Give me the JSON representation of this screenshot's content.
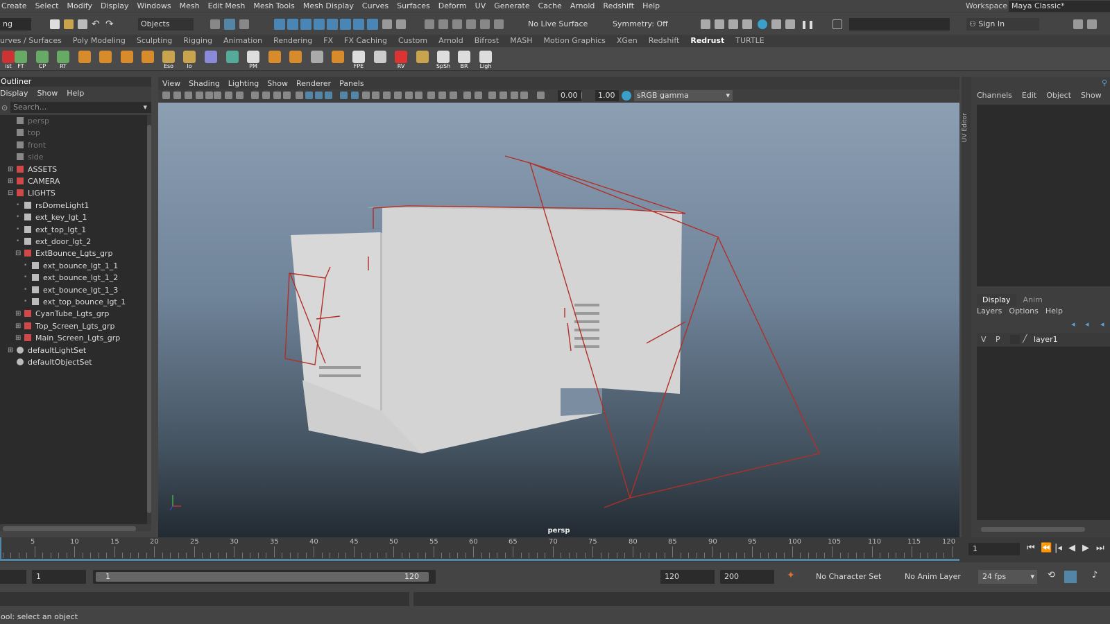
{
  "menubar": {
    "items": [
      "Create",
      "Select",
      "Modify",
      "Display",
      "Windows",
      "Mesh",
      "Edit Mesh",
      "Mesh Tools",
      "Mesh Display",
      "Curves",
      "Surfaces",
      "Deform",
      "UV",
      "Generate",
      "Cache",
      "Arnold",
      "Redshift",
      "Help"
    ],
    "workspace_label": "Workspace :",
    "workspace_value": "Maya Classic*"
  },
  "statusline": {
    "mode_dropdown": "ng",
    "objects_label": "Objects",
    "live_surface": "No Live Surface",
    "symmetry": "Symmetry: Off",
    "sign_in": "Sign In"
  },
  "shelf": {
    "tabs": [
      "urves / Surfaces",
      "Poly Modeling",
      "Sculpting",
      "Rigging",
      "Animation",
      "Rendering",
      "FX",
      "FX Caching",
      "Custom",
      "Arnold",
      "Bifrost",
      "MASH",
      "Motion Graphics",
      "XGen",
      "Redshift",
      "Redrust",
      "TURTLE"
    ],
    "active_tab": "Redrust",
    "icon_labels": [
      "ist",
      "FT",
      "CP",
      "RT",
      "",
      "",
      "",
      "",
      "Eso",
      "Io",
      "",
      "",
      "PM",
      "",
      "",
      "",
      "",
      "FPE",
      "",
      "RV",
      "",
      "SpSh",
      "BR",
      "Ligh"
    ]
  },
  "outliner": {
    "title": "Outliner",
    "menu": [
      "Display",
      "Show",
      "Help"
    ],
    "search_placeholder": "Search...",
    "items": [
      {
        "label": "persp",
        "indent": 0,
        "type": "camera",
        "dim": true
      },
      {
        "label": "top",
        "indent": 0,
        "type": "camera",
        "dim": true
      },
      {
        "label": "front",
        "indent": 0,
        "type": "camera",
        "dim": true
      },
      {
        "label": "side",
        "indent": 0,
        "type": "camera",
        "dim": true
      },
      {
        "label": "ASSETS",
        "indent": 0,
        "type": "group",
        "expand": "+"
      },
      {
        "label": "CAMERA",
        "indent": 0,
        "type": "group",
        "expand": "+"
      },
      {
        "label": "LIGHTS",
        "indent": 0,
        "type": "group",
        "expand": "-"
      },
      {
        "label": "rsDomeLight1",
        "indent": 1,
        "type": "light"
      },
      {
        "label": "ext_key_lgt_1",
        "indent": 1,
        "type": "light"
      },
      {
        "label": "ext_top_lgt_1",
        "indent": 1,
        "type": "light"
      },
      {
        "label": "ext_door_lgt_2",
        "indent": 1,
        "type": "light"
      },
      {
        "label": "ExtBounce_Lgts_grp",
        "indent": 1,
        "type": "group",
        "expand": "-"
      },
      {
        "label": "ext_bounce_lgt_1_1",
        "indent": 2,
        "type": "light"
      },
      {
        "label": "ext_bounce_lgt_1_2",
        "indent": 2,
        "type": "light"
      },
      {
        "label": "ext_bounce_lgt_1_3",
        "indent": 2,
        "type": "light"
      },
      {
        "label": "ext_top_bounce_lgt_1",
        "indent": 2,
        "type": "light"
      },
      {
        "label": "CyanTube_Lgts_grp",
        "indent": 1,
        "type": "group",
        "expand": "+"
      },
      {
        "label": "Top_Screen_Lgts_grp",
        "indent": 1,
        "type": "group",
        "expand": "+"
      },
      {
        "label": "Main_Screen_Lgts_grp",
        "indent": 1,
        "type": "group",
        "expand": "+"
      },
      {
        "label": "defaultLightSet",
        "indent": 0,
        "type": "set",
        "expand": "+"
      },
      {
        "label": "defaultObjectSet",
        "indent": 0,
        "type": "set"
      }
    ]
  },
  "viewport": {
    "menu": [
      "View",
      "Shading",
      "Lighting",
      "Show",
      "Renderer",
      "Panels"
    ],
    "exposure": "0.00",
    "gamma": "1.00",
    "color_space": "sRGB gamma",
    "camera_label": "persp",
    "uv_editor_tab": "UV Editor"
  },
  "channel_box": {
    "menu": [
      "Channels",
      "Edit",
      "Object",
      "Show"
    ]
  },
  "layer_editor": {
    "tabs": [
      "Display",
      "Anim"
    ],
    "menu": [
      "Layers",
      "Options",
      "Help"
    ],
    "layer": {
      "v": "V",
      "p": "P",
      "name": "layer1"
    }
  },
  "timeline": {
    "ticks": [
      "5",
      "10",
      "15",
      "20",
      "25",
      "30",
      "35",
      "40",
      "45",
      "50",
      "55",
      "60",
      "65",
      "70",
      "75",
      "80",
      "85",
      "90",
      "95",
      "100",
      "105",
      "110",
      "115",
      "120"
    ],
    "current_frame": "1"
  },
  "range": {
    "start_outer": "1",
    "start_inner": "1",
    "end_inner": "120",
    "end": "120",
    "end_outer": "200",
    "character_set": "No Character Set",
    "anim_layer": "No Anim Layer",
    "fps": "24 fps"
  },
  "help_line": "ool: select an object",
  "colors": {
    "accent": "#5285a6",
    "light_wire": "#b03028",
    "active_tab": "#ffffff"
  }
}
